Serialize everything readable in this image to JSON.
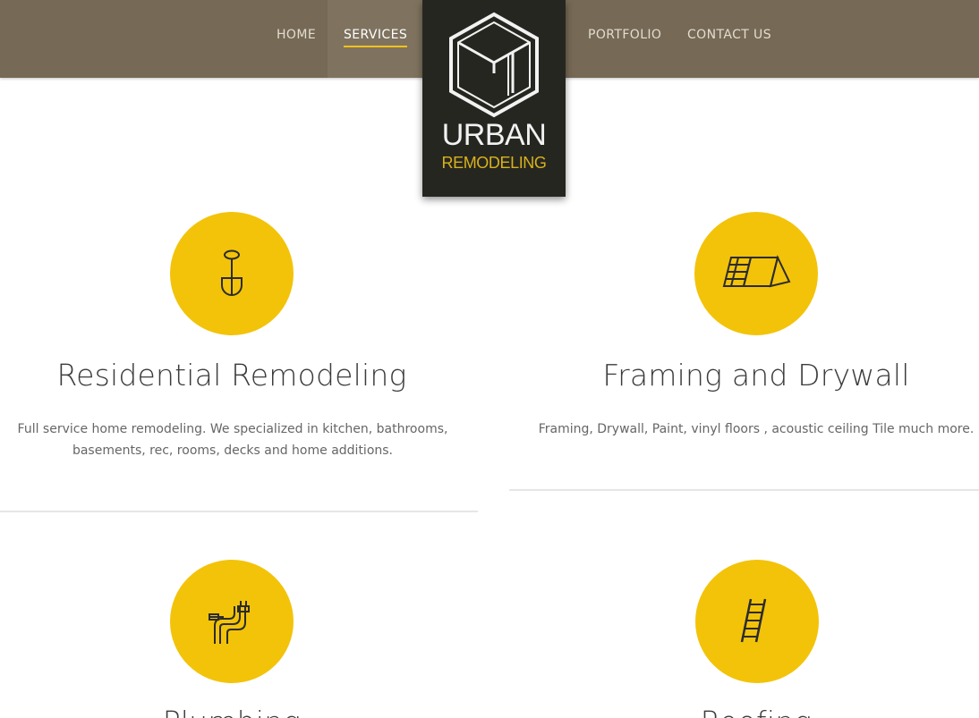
{
  "nav": {
    "items": [
      {
        "label": "HOME",
        "active": false
      },
      {
        "label": "SERVICES",
        "active": true
      },
      {
        "label": "PORTFOLIO",
        "active": false
      },
      {
        "label": "CONTACT US",
        "active": false
      }
    ]
  },
  "logo": {
    "line1": "URBAN",
    "line2": "REMODELING",
    "icon": "cube-logo-icon"
  },
  "services": [
    {
      "title": "Residential Remodeling",
      "description": "Full service home remodeling. We specialized in kitchen, bathrooms, basements, rec, rooms, decks and home additions.",
      "icon": "shovel-icon"
    },
    {
      "title": "Framing and Drywall",
      "description": "Framing, Drywall, Paint, vinyl floors , acoustic ceiling Tile much more.",
      "icon": "drywall-panels-icon"
    },
    {
      "title": "Plumbing",
      "icon": "pipes-icon"
    },
    {
      "title": "Roofing",
      "icon": "ladder-icon"
    }
  ],
  "colors": {
    "header": "#766955",
    "accent": "#f3c309",
    "logo_bg": "#262621",
    "logo_sub": "#d8b21c"
  }
}
